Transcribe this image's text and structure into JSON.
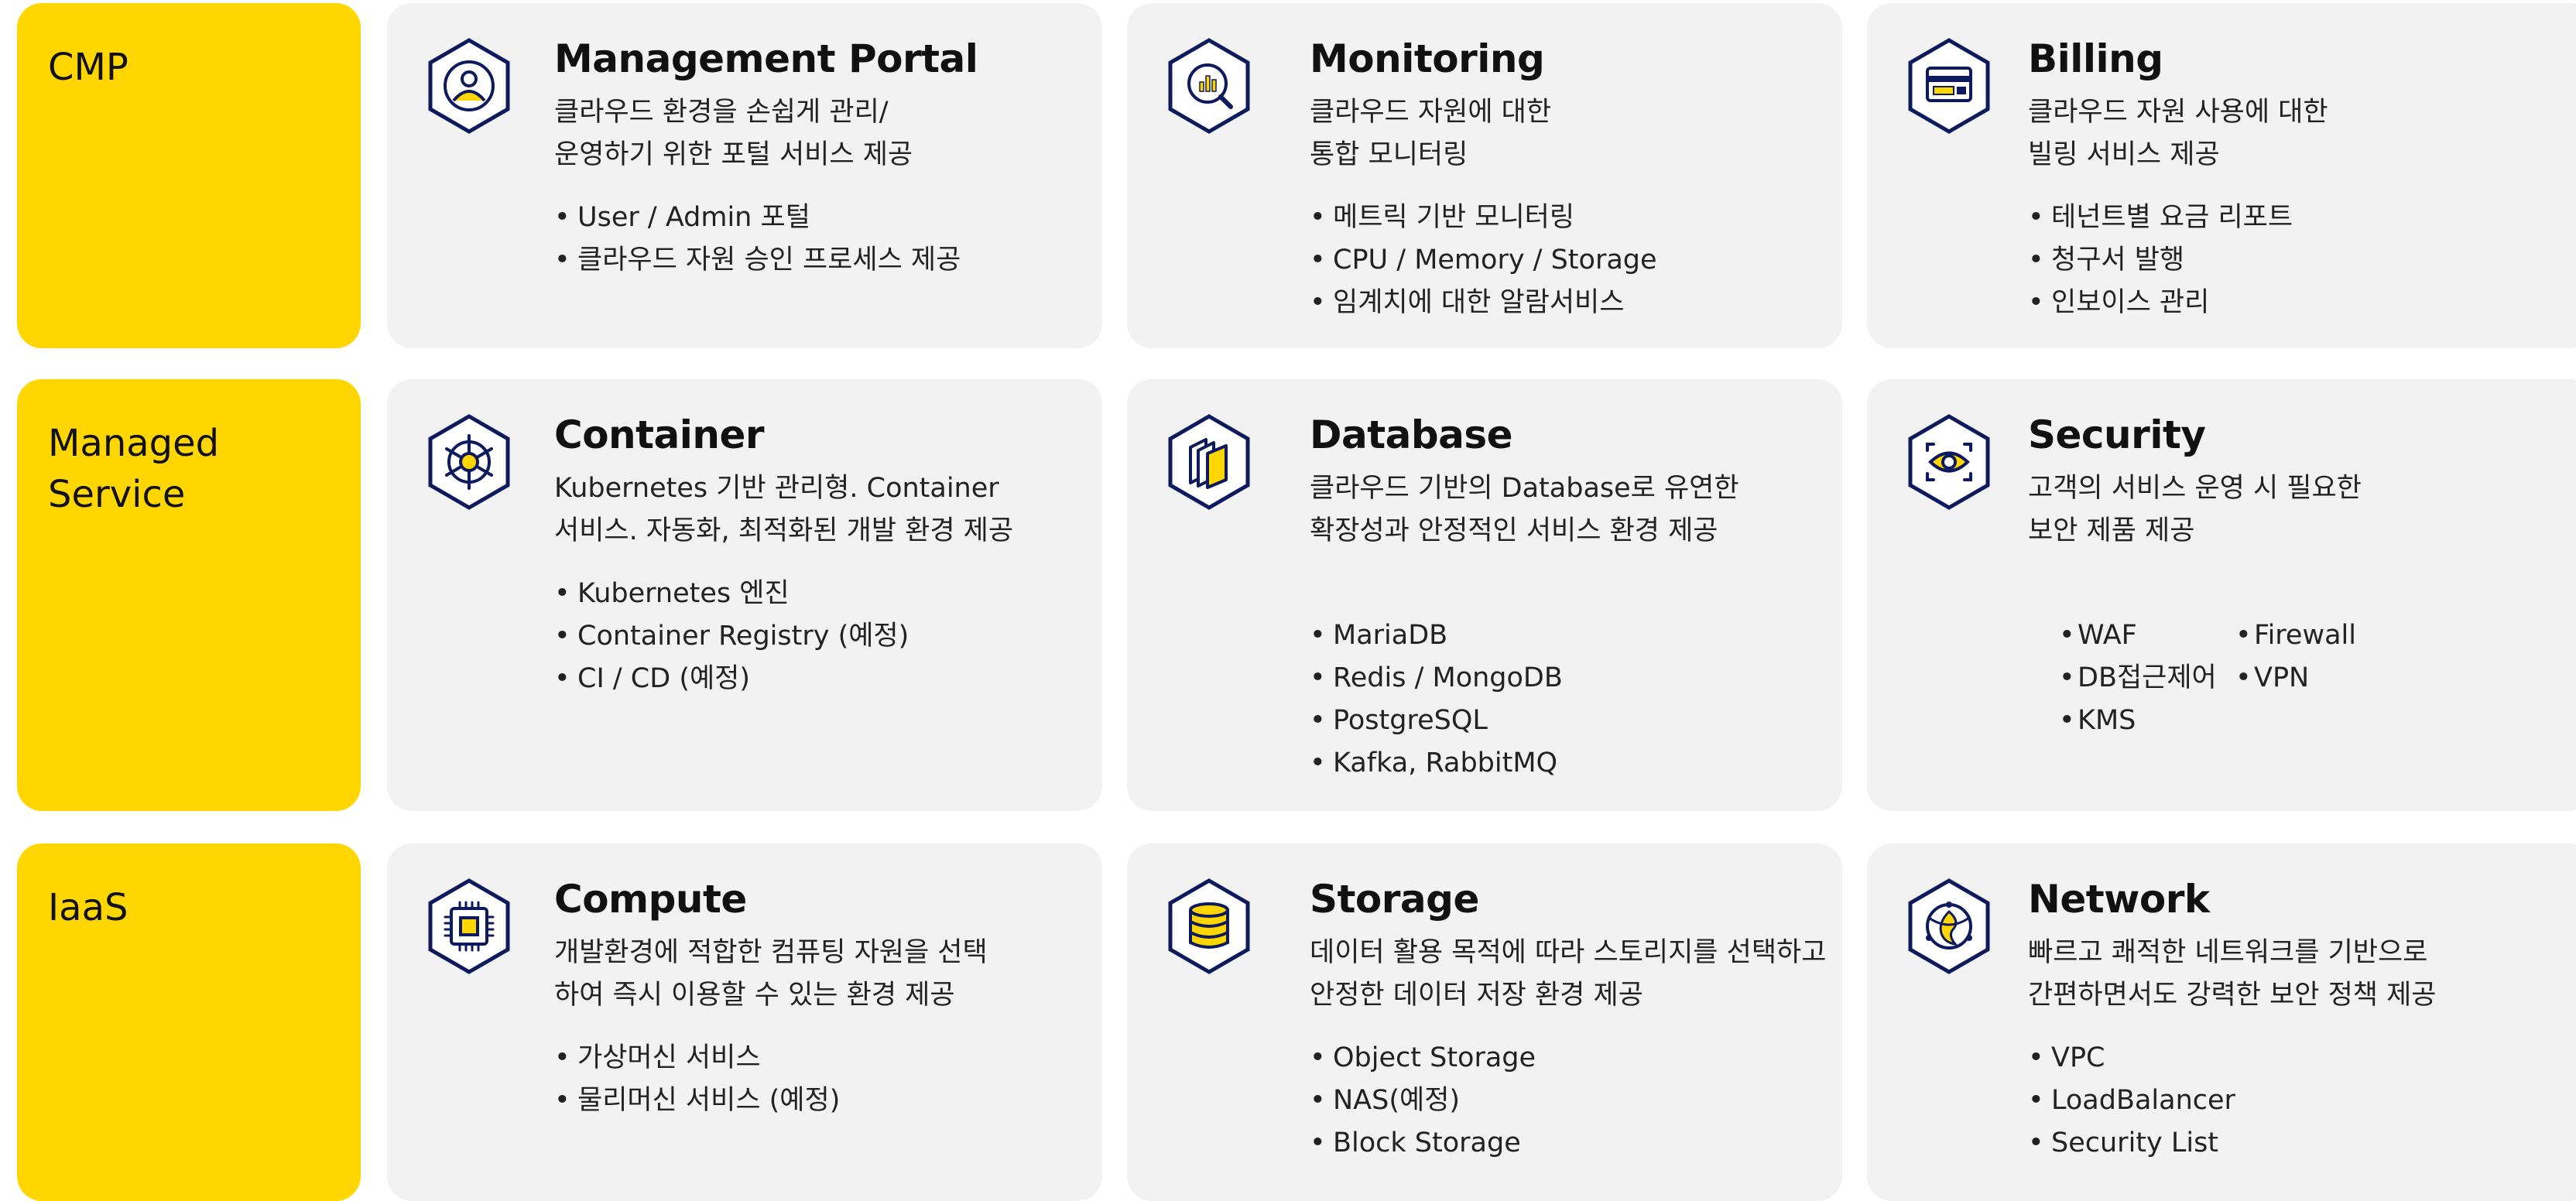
{
  "colors": {
    "accent": "#FFD600",
    "card_bg": "#F2F2F2",
    "icon_navy": "#0E1A5E"
  },
  "rows": [
    {
      "category": "CMP",
      "cards": [
        {
          "icon": "user-icon",
          "title": "Management Portal",
          "description": "클라우드 환경을 손쉽게 관리/\n 운영하기 위한 포털 서비스 제공",
          "bullets": [
            "User / Admin 포털",
            "클라우드 자원 승인 프로세스 제공"
          ]
        },
        {
          "icon": "monitoring-magnifier-icon",
          "title": "Monitoring",
          "description": "클라우드 자원에 대한\n통합 모니터링",
          "bullets": [
            "메트릭 기반 모니터링",
            "CPU / Memory / Storage",
            "임계치에 대한 알람서비스"
          ]
        },
        {
          "icon": "billing-card-icon",
          "title": "Billing",
          "description": "클라우드 자원 사용에 대한\n빌링 서비스 제공",
          "bullets": [
            "테넌트별 요금 리포트",
            "청구서 발행",
            "인보이스 관리"
          ]
        }
      ]
    },
    {
      "category": "Managed\nService",
      "cards": [
        {
          "icon": "helm-wheel-icon",
          "title": "Container",
          "description": "Kubernetes 기반 관리형.  Container\n서비스. 자동화, 최적화된  개발 환경 제공",
          "bullets": [
            "Kubernetes  엔진",
            "Container Registry (예정)",
            "CI / CD (예정)"
          ]
        },
        {
          "icon": "database-files-icon",
          "title": "Database",
          "description": "클라우드 기반의 Database로 유연한\n확장성과 안정적인 서비스 환경 제공",
          "bullets": [
            "MariaDB",
            "Redis / MongoDB",
            "PostgreSQL",
            "Kafka, RabbitMQ"
          ]
        },
        {
          "icon": "security-eye-icon",
          "title": "Security",
          "description": "고객의 서비스 운영 시 필요한\n보안 제품 제공",
          "bullets": [
            "WAF",
            "Firewall",
            "DB접근제어",
            "VPN",
            "KMS"
          ]
        }
      ]
    },
    {
      "category": "IaaS",
      "cards": [
        {
          "icon": "cpu-chip-icon",
          "title": "Compute",
          "description": "개발환경에 적합한 컴퓨팅 자원을  선택\n하여 즉시 이용할 수 있는 환경 제공",
          "bullets": [
            "가상머신 서비스",
            "물리머신 서비스 (예정)"
          ]
        },
        {
          "icon": "storage-disk-icon",
          "title": "Storage",
          "description": "데이터 활용 목적에 따라 스토리지를 선택하고\n안정한 데이터 저장 환경 제공",
          "bullets": [
            "Object Storage",
            "NAS(예정)",
            "Block Storage"
          ]
        },
        {
          "icon": "network-globe-icon",
          "title": "Network",
          "description": "빠르고 쾌적한 네트워크를 기반으로\n간편하면서도 강력한 보안 정책 제공",
          "bullets": [
            "VPC",
            "LoadBalancer",
            "Security List"
          ]
        }
      ]
    }
  ]
}
